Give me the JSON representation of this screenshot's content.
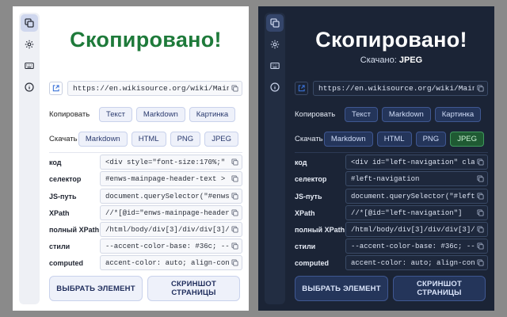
{
  "light": {
    "title": "Скопировано!",
    "url": "https://en.wikisource.org/wiki/Main_Page",
    "copy_label": "Копировать",
    "copy_buttons": [
      "Текст",
      "Markdown",
      "Картинка"
    ],
    "download_label": "Скачать",
    "download_buttons": [
      "Markdown",
      "HTML",
      "PNG",
      "JPEG"
    ],
    "selectors": [
      {
        "label": "код",
        "value": "<div style=\"font-size:170%;\" cla"
      },
      {
        "label": "селектор",
        "value": "#enws-mainpage-header-text > div"
      },
      {
        "label": "JS-путь",
        "value": "document.querySelector(\"#enws-ma"
      },
      {
        "label": "XPath",
        "value": "//*[@id=\"enws-mainpage-header-te"
      },
      {
        "label": "полный XPath",
        "value": "/html/body/div[3]/div/div[3]/mai"
      },
      {
        "label": "стили",
        "value": "--accent-color-base: #36c; --bac"
      },
      {
        "label": "computed",
        "value": "accent-color: auto; align-conten"
      }
    ],
    "select_button": "ВЫБРАТЬ ЭЛЕМЕНТ",
    "screenshot_button_line1": "СКРИНШОТ",
    "screenshot_button_line2": "СТРАНИЦЫ"
  },
  "dark": {
    "title": "Скопировано!",
    "subtitle_prefix": "Скачано:",
    "subtitle_value": "JPEG",
    "url": "https://en.wikisource.org/wiki/Main_Page",
    "copy_label": "Копировать",
    "copy_buttons": [
      "Текст",
      "Markdown",
      "Картинка"
    ],
    "download_label": "Скачать",
    "download_buttons": [
      "Markdown",
      "HTML",
      "PNG",
      "JPEG"
    ],
    "selectors": [
      {
        "label": "код",
        "value": "<div id=\"left-navigation\" class="
      },
      {
        "label": "селектор",
        "value": "#left-navigation"
      },
      {
        "label": "JS-путь",
        "value": "document.querySelector(\"#left-na"
      },
      {
        "label": "XPath",
        "value": "//*[@id=\"left-navigation\"]"
      },
      {
        "label": "полный XPath",
        "value": "/html/body/div[3]/div/div[3]/mai"
      },
      {
        "label": "стили",
        "value": "--accent-color-base: #36c; --bac"
      },
      {
        "label": "computed",
        "value": "accent-color: auto; align-conten"
      }
    ],
    "select_button": "ВЫБРАТЬ ЭЛЕМЕНТ",
    "screenshot_button_line1": "СКРИНШОТ",
    "screenshot_button_line2": "СТРАНИЦЫ"
  },
  "sidebar_icons": [
    "copy-icon",
    "gear-icon",
    "keyboard-icon",
    "info-icon"
  ],
  "colors": {
    "success_green": "#1e7a3a",
    "accent_blue": "#3a72d8",
    "dark_bg": "#1b2436"
  }
}
